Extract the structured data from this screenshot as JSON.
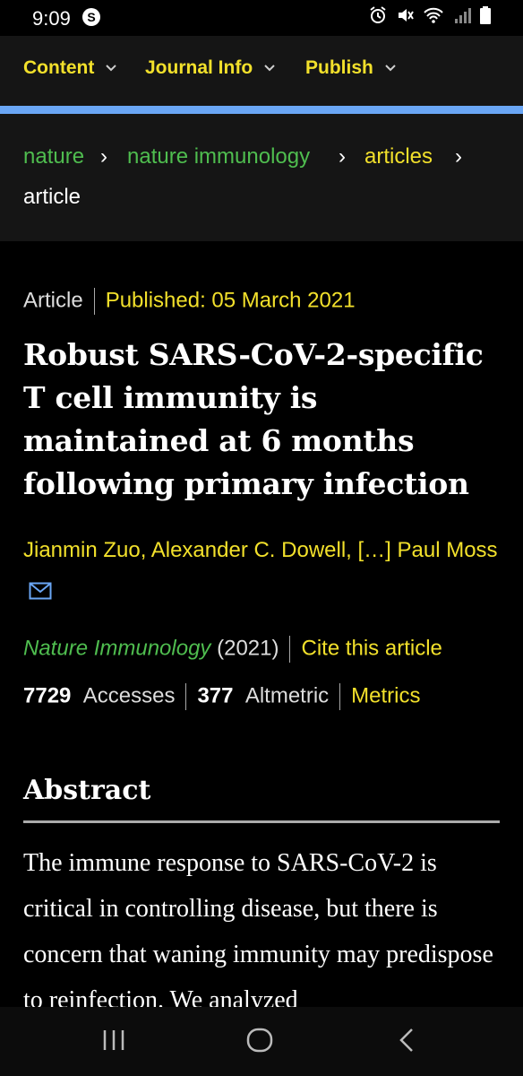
{
  "status_bar": {
    "time": "9:09",
    "app_icon_letter": "S"
  },
  "top_nav": {
    "items": [
      {
        "label": "Content"
      },
      {
        "label": "Journal Info"
      },
      {
        "label": "Publish"
      }
    ],
    "accent_color": "#6aa6f5"
  },
  "breadcrumb": {
    "items": [
      {
        "label": "nature"
      },
      {
        "label": "nature immunology"
      },
      {
        "label": "articles"
      },
      {
        "label": "article"
      }
    ]
  },
  "article": {
    "type": "Article",
    "published": "Published: 05 March 2021",
    "title": "Robust SARS-CoV-2-specific T cell immunity is maintained at 6 months following primary infection",
    "authors": "Jianmin Zuo, Alexander C. Dowell, […] Paul Moss",
    "journal": "Nature Immunology",
    "year": "(2021)",
    "cite_label": "Cite this article",
    "accesses_count": "7729",
    "accesses_label": "Accesses",
    "altmetric_count": "377",
    "altmetric_label": "Altmetric",
    "metrics_label": "Metrics"
  },
  "abstract": {
    "heading": "Abstract",
    "text": "The immune response to SARS-CoV-2 is critical in controlling disease, but there is concern that waning immunity may predispose to reinfection. We analyzed"
  },
  "colors": {
    "link_yellow": "#f2e02b",
    "link_green": "#4fbd4f",
    "background": "#000000"
  }
}
